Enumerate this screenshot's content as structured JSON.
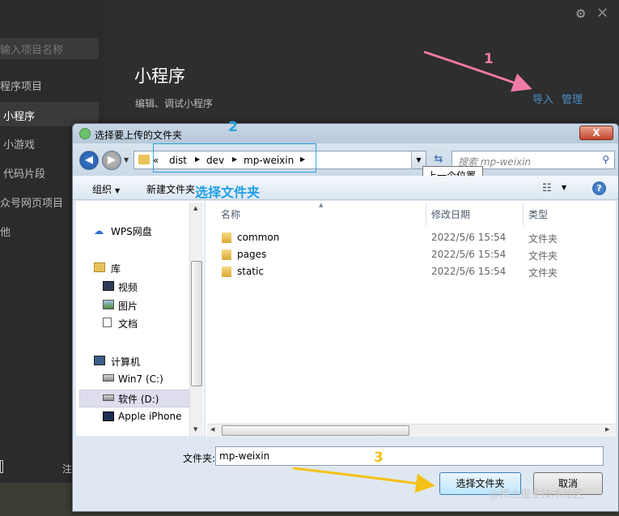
{
  "background_app": {
    "search_placeholder": "输入项目名称",
    "sidebar_items": [
      "程序项目",
      "小程序",
      "小游戏",
      "代码片段",
      "众号网页项目",
      "他"
    ],
    "active_item": "小程序",
    "title": "小程序",
    "subtitle": "编辑、调试小程序",
    "import_link": "导入",
    "manage_link": "管理",
    "bottom_partial_text": "注"
  },
  "dialog": {
    "title": "选择要上传的文件夹",
    "close_glyph": "X",
    "address": {
      "overflow": "«",
      "crumbs": [
        "dist",
        "dev",
        "mp-weixin"
      ]
    },
    "search_placeholder": "搜索 mp-weixin",
    "tooltip": "上一个位置",
    "toolbar": {
      "organize": "组织",
      "new_folder": "新建文件夹"
    },
    "nav_pane": {
      "items": [
        {
          "label": "WPS网盘",
          "icon": "cloud-icon"
        },
        {
          "label": "库",
          "icon": "library-icon"
        },
        {
          "label": "视频",
          "icon": "video-icon"
        },
        {
          "label": "图片",
          "icon": "picture-icon"
        },
        {
          "label": "文档",
          "icon": "document-icon"
        },
        {
          "label": "计算机",
          "icon": "computer-icon"
        },
        {
          "label": "Win7 (C:)",
          "icon": "drive-icon"
        },
        {
          "label": "软件 (D:)",
          "icon": "drive-icon"
        },
        {
          "label": "Apple iPhone",
          "icon": "phone-icon"
        }
      ],
      "selected": "软件 (D:)"
    },
    "columns": {
      "name": "名称",
      "date": "修改日期",
      "type": "类型"
    },
    "files": [
      {
        "name": "common",
        "date": "2022/5/6 15:54",
        "type": "文件夹"
      },
      {
        "name": "pages",
        "date": "2022/5/6 15:54",
        "type": "文件夹"
      },
      {
        "name": "static",
        "date": "2022/5/6 15:54",
        "type": "文件夹"
      }
    ],
    "folder_label": "文件夹:",
    "folder_value": "mp-weixin",
    "ok_button": "选择文件夹",
    "cancel_button": "取消"
  },
  "annotations": {
    "step1": "1",
    "step2": "2",
    "step3": "3",
    "step2_label": "选择文件夹",
    "arrow1_color": "#f07aa8",
    "arrow3_color": "#f5c21a",
    "box_color": "#2aa6e0"
  },
  "watermark": "@稀土掘金技术社区"
}
